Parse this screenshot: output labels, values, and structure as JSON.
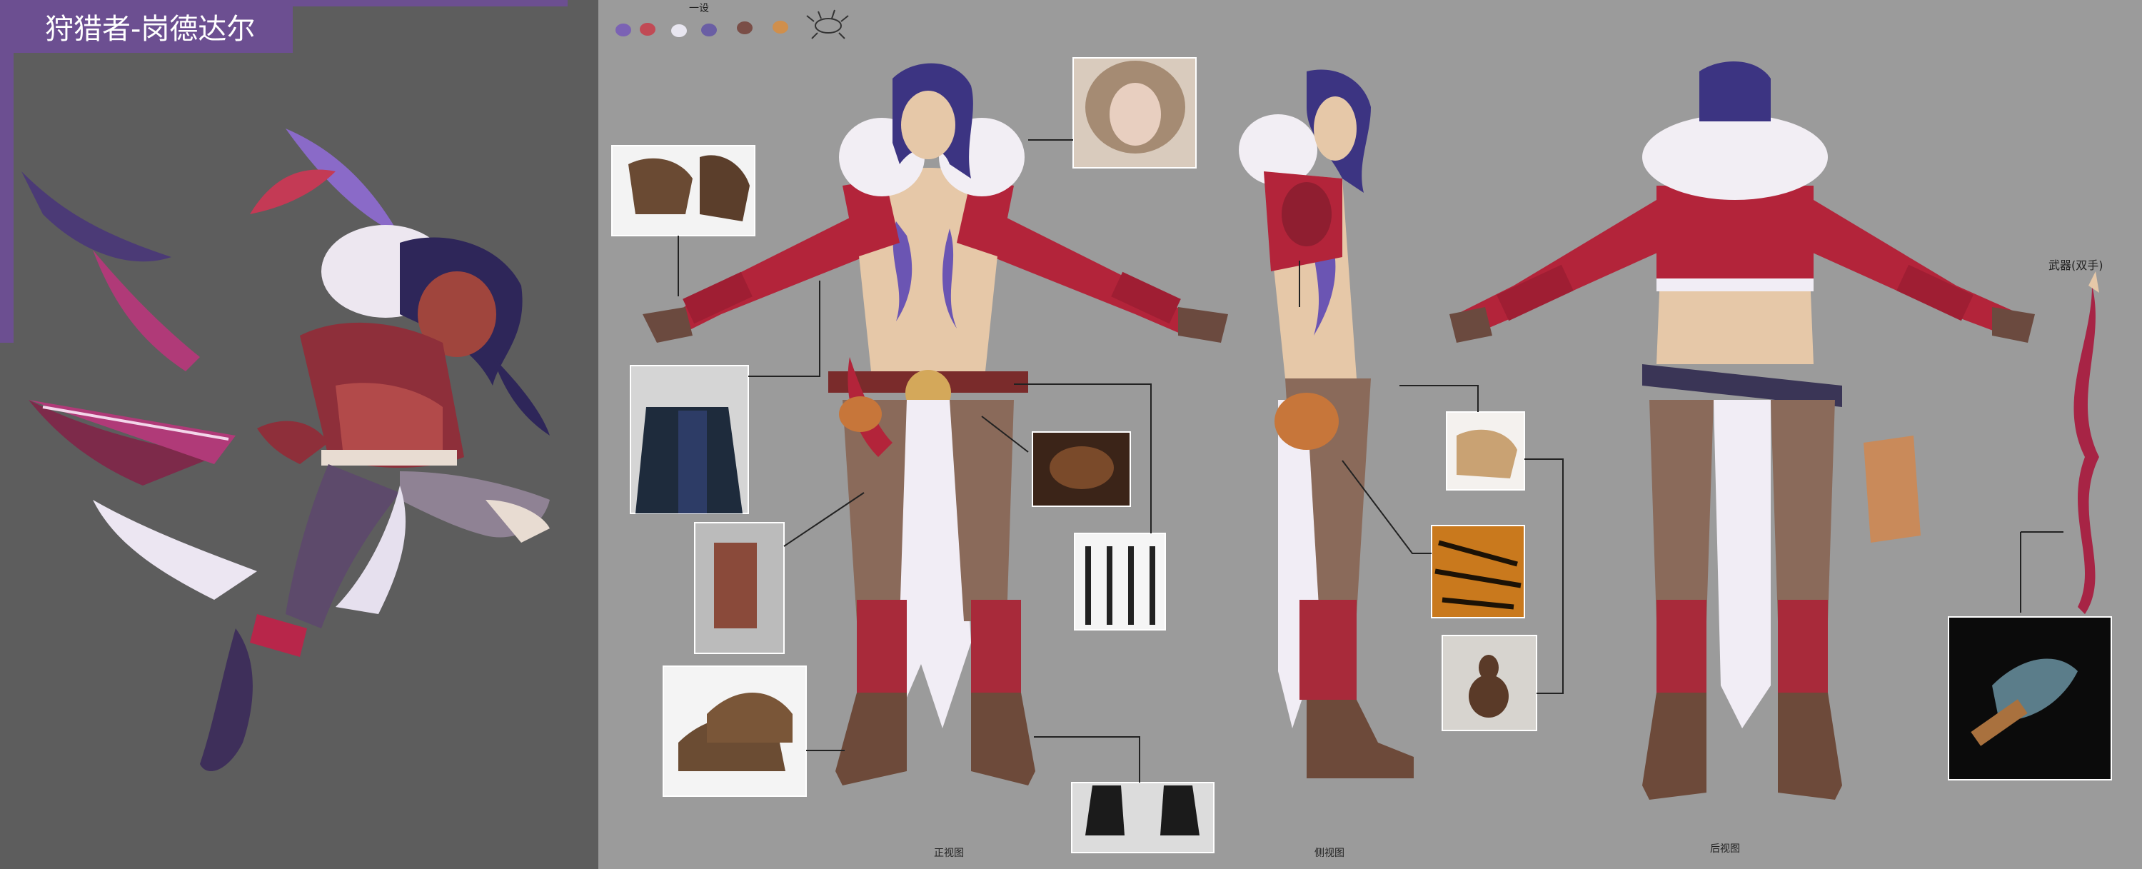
{
  "title": "狩猎者-岗德达尔",
  "palette": {
    "label": "一设",
    "colors": [
      "#7b62b4",
      "#c14a55",
      "#e8e6f0",
      "#6a5ea4",
      "#7a4e47",
      "#d08f4c"
    ],
    "doodle_icon": "bug-sketch-icon"
  },
  "views": {
    "front": "正视图",
    "side": "侧视图",
    "back": "后视图"
  },
  "weapon_label": "武器(双手)",
  "references": [
    "fingerless-leather-gloves-photo",
    "fur-hood-parka-photo",
    "leather-jacket-photo",
    "leg-holster-strap-photo",
    "suede-desert-boots-photo",
    "bear-claw-ornament-photo",
    "dagger-sheath-set-photo",
    "black-leather-boots-photo",
    "leather-pouch-photo",
    "tiger-fur-photo",
    "gourd-flask-photo",
    "battle-axe-photo"
  ]
}
